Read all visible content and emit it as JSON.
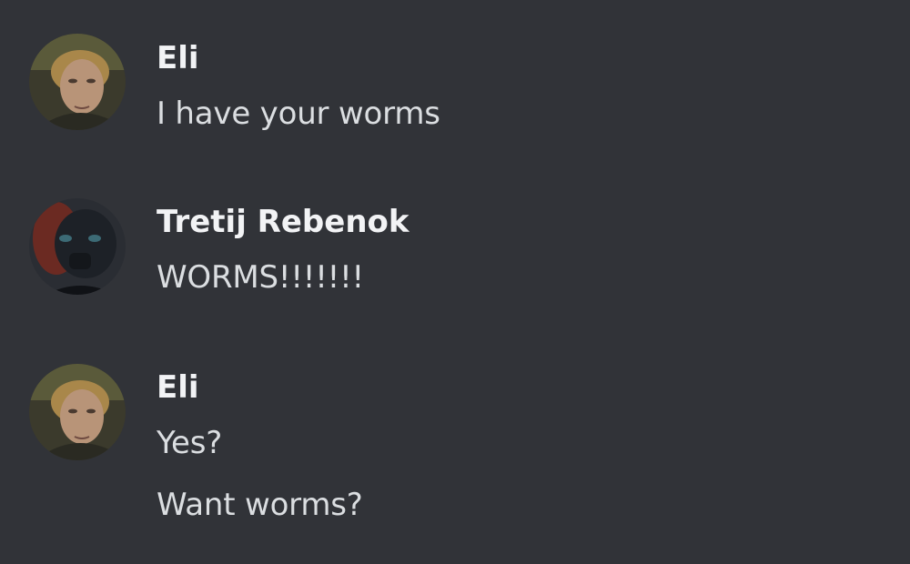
{
  "messages": [
    {
      "author": "Eli",
      "avatar_icon": "avatar-eli",
      "lines": [
        "I have your worms"
      ]
    },
    {
      "author": "Tretij Rebenok",
      "avatar_icon": "avatar-tretij-rebenok",
      "lines": [
        "WORMS!!!!!!!"
      ]
    },
    {
      "author": "Eli",
      "avatar_icon": "avatar-eli",
      "lines": [
        "Yes?",
        "Want worms?"
      ]
    }
  ],
  "colors": {
    "background": "#313338",
    "author": "#f2f3f5",
    "message_text": "#dbdee1"
  }
}
